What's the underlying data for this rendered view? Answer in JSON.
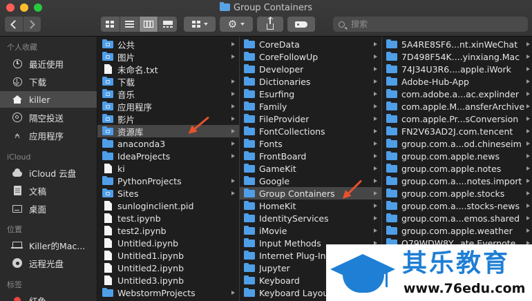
{
  "window": {
    "title": "Group Containers"
  },
  "toolbar": {
    "search": {
      "placeholder": "搜索",
      "value": ""
    }
  },
  "sidebar": {
    "sections": [
      {
        "title": "个人收藏"
      },
      {
        "title": "iCloud"
      },
      {
        "title": "位置"
      },
      {
        "title": "标签"
      }
    ],
    "items": [
      {
        "label": "最近使用",
        "icon": "clock-icon"
      },
      {
        "label": "下载",
        "icon": "download-icon"
      },
      {
        "label": "killer",
        "icon": "home-icon",
        "selected": true
      },
      {
        "label": "隔空投送",
        "icon": "airdrop-icon"
      },
      {
        "label": "应用程序",
        "icon": "applications-icon"
      },
      {
        "label": "iCloud 云盘",
        "icon": "cloud-icon"
      },
      {
        "label": "文稿",
        "icon": "document-icon"
      },
      {
        "label": "桌面",
        "icon": "desktop-icon"
      },
      {
        "label": "Killer的Mac...",
        "icon": "laptop-icon"
      },
      {
        "label": "远程光盘",
        "icon": "disc-icon"
      },
      {
        "label": "红色",
        "icon": "red-tag-icon"
      }
    ]
  },
  "columns": [
    {
      "items": [
        {
          "label": "公共",
          "type": "folder-sys",
          "arrow": true
        },
        {
          "label": "图片",
          "type": "folder-sys",
          "arrow": true
        },
        {
          "label": "未命名.txt",
          "type": "file",
          "arrow": false
        },
        {
          "label": "下载",
          "type": "folder-sys",
          "arrow": true
        },
        {
          "label": "音乐",
          "type": "folder-sys",
          "arrow": true
        },
        {
          "label": "应用程序",
          "type": "folder-sys",
          "arrow": true
        },
        {
          "label": "影片",
          "type": "folder-sys",
          "arrow": true
        },
        {
          "label": "资源库",
          "type": "folder-sys",
          "arrow": true,
          "selected": true
        },
        {
          "label": "anaconda3",
          "type": "folder",
          "arrow": true
        },
        {
          "label": "IdeaProjects",
          "type": "folder",
          "arrow": true
        },
        {
          "label": "ki",
          "type": "file",
          "arrow": false
        },
        {
          "label": "PythonProjects",
          "type": "folder",
          "arrow": true
        },
        {
          "label": "Sites",
          "type": "folder-sys",
          "arrow": true
        },
        {
          "label": "sunloginclient.pid",
          "type": "file",
          "arrow": false
        },
        {
          "label": "test.ipynb",
          "type": "file",
          "arrow": false
        },
        {
          "label": "test2.ipynb",
          "type": "file",
          "arrow": false
        },
        {
          "label": "Untitled.ipynb",
          "type": "file",
          "arrow": false
        },
        {
          "label": "Untitled1.ipynb",
          "type": "file",
          "arrow": false
        },
        {
          "label": "Untitled2.ipynb",
          "type": "file",
          "arrow": false
        },
        {
          "label": "Untitled3.ipynb",
          "type": "file",
          "arrow": false
        },
        {
          "label": "WebstormProjects",
          "type": "folder",
          "arrow": true
        }
      ]
    },
    {
      "items": [
        {
          "label": "CoreData",
          "type": "folder",
          "arrow": true
        },
        {
          "label": "CoreFollowUp",
          "type": "folder",
          "arrow": true
        },
        {
          "label": "Developer",
          "type": "folder",
          "arrow": true
        },
        {
          "label": "Dictionaries",
          "type": "folder",
          "arrow": true
        },
        {
          "label": "Esurfing",
          "type": "folder",
          "arrow": true
        },
        {
          "label": "Family",
          "type": "folder",
          "arrow": true
        },
        {
          "label": "FileProvider",
          "type": "folder",
          "arrow": true
        },
        {
          "label": "FontCollections",
          "type": "folder",
          "arrow": true
        },
        {
          "label": "Fonts",
          "type": "folder",
          "arrow": true
        },
        {
          "label": "FrontBoard",
          "type": "folder",
          "arrow": true
        },
        {
          "label": "GameKit",
          "type": "folder",
          "arrow": true
        },
        {
          "label": "Google",
          "type": "folder",
          "arrow": true
        },
        {
          "label": "Group Containers",
          "type": "folder",
          "arrow": true,
          "selected": true
        },
        {
          "label": "HomeKit",
          "type": "folder",
          "arrow": true
        },
        {
          "label": "IdentityServices",
          "type": "folder",
          "arrow": true
        },
        {
          "label": "iMovie",
          "type": "folder",
          "arrow": true
        },
        {
          "label": "Input Methods",
          "type": "folder",
          "arrow": true
        },
        {
          "label": "Internet Plug-Ins",
          "type": "folder",
          "arrow": true
        },
        {
          "label": "Jupyter",
          "type": "folder",
          "arrow": true
        },
        {
          "label": "Keyboard",
          "type": "folder",
          "arrow": true
        },
        {
          "label": "Keyboard Layouts",
          "type": "folder",
          "arrow": true
        }
      ]
    },
    {
      "items": [
        {
          "label": "5A4RE8SF6...nt.xinWeChat",
          "type": "folder",
          "arrow": true
        },
        {
          "label": "7D498F54K....yinxiang.Mac",
          "type": "folder",
          "arrow": true
        },
        {
          "label": "74J34U3R6....apple.iWork",
          "type": "folder",
          "arrow": true
        },
        {
          "label": "Adobe-Hub-App",
          "type": "folder",
          "arrow": true
        },
        {
          "label": "com.adobe.a...ac.explinder",
          "type": "folder",
          "arrow": true
        },
        {
          "label": "com.apple.M...ansferArchive",
          "type": "folder",
          "arrow": true
        },
        {
          "label": "com.apple.Pr...sConversion",
          "type": "folder",
          "arrow": true
        },
        {
          "label": "FN2V63AD2J.com.tencent",
          "type": "folder",
          "arrow": true
        },
        {
          "label": "group.com.a...od.chineseim",
          "type": "folder",
          "arrow": true
        },
        {
          "label": "group.com.apple.news",
          "type": "folder",
          "arrow": true
        },
        {
          "label": "group.com.apple.notes",
          "type": "folder",
          "arrow": true
        },
        {
          "label": "group.com.a....notes.import",
          "type": "folder",
          "arrow": true
        },
        {
          "label": "group.com.apple.stocks",
          "type": "folder",
          "arrow": true
        },
        {
          "label": "group.com.a....stocks-news",
          "type": "folder",
          "arrow": true
        },
        {
          "label": "group.com.a...emos.shared",
          "type": "folder",
          "arrow": true
        },
        {
          "label": "group.com.apple.weather",
          "type": "folder",
          "arrow": true
        },
        {
          "label": "Q79WDW8Y...ate.Evernote",
          "type": "folder",
          "arrow": true
        }
      ]
    }
  ],
  "watermark": {
    "title": "其乐教育",
    "url": "www.76edu.com"
  },
  "colors": {
    "accent": "#4f9ee8",
    "annotation": "#e8522b",
    "watermark_blue": "#1f7fd4"
  }
}
